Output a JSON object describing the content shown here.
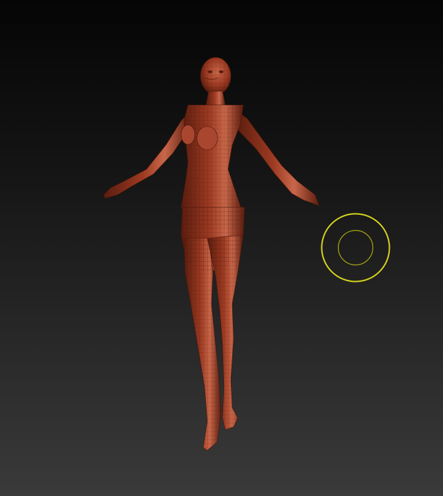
{
  "canvas": {
    "background_top": "#050505",
    "background_bottom": "#3a3a3a"
  },
  "model": {
    "icon": "sculpt-figure-icon",
    "material_color": "#9c3a22",
    "highlight_color": "#c8674a",
    "shadow_color": "#5a1c0e",
    "wireframe_visible": true
  },
  "brush": {
    "icon": "brush-draw-size-ring-icon",
    "ring_color": "#d6d61e"
  }
}
